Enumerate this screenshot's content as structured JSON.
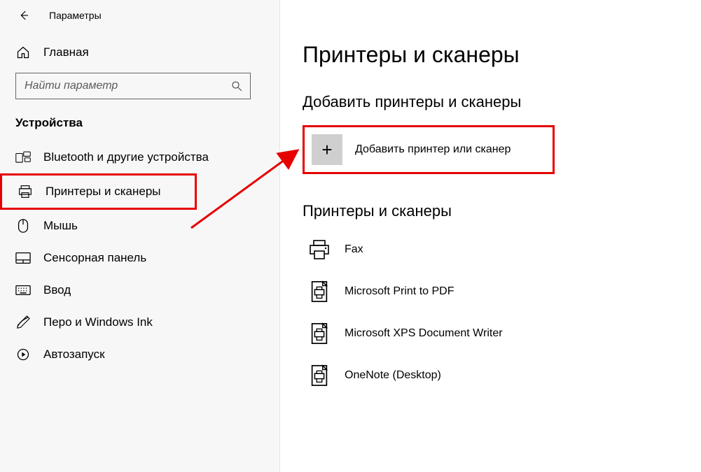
{
  "window": {
    "title": "Параметры"
  },
  "sidebar": {
    "home_label": "Главная",
    "search_placeholder": "Найти параметр",
    "section_title": "Устройства",
    "items": [
      {
        "label": "Bluetooth и другие устройства",
        "icon": "bluetooth-devices-icon"
      },
      {
        "label": "Принтеры и сканеры",
        "icon": "printer-icon"
      },
      {
        "label": "Мышь",
        "icon": "mouse-icon"
      },
      {
        "label": "Сенсорная панель",
        "icon": "touchpad-icon"
      },
      {
        "label": "Ввод",
        "icon": "keyboard-icon"
      },
      {
        "label": "Перо и Windows Ink",
        "icon": "pen-icon"
      },
      {
        "label": "Автозапуск",
        "icon": "autoplay-icon"
      }
    ]
  },
  "main": {
    "page_title": "Принтеры и сканеры",
    "add_header": "Добавить принтеры и сканеры",
    "add_button_label": "Добавить принтер или сканер",
    "list_header": "Принтеры и сканеры",
    "printers": [
      {
        "label": "Fax"
      },
      {
        "label": "Microsoft Print to PDF"
      },
      {
        "label": "Microsoft XPS Document Writer"
      },
      {
        "label": "OneNote (Desktop)"
      }
    ]
  },
  "annotations": {
    "highlight_sidebar_index": 1,
    "highlight_add_button": true,
    "arrow_color": "#e60000"
  }
}
